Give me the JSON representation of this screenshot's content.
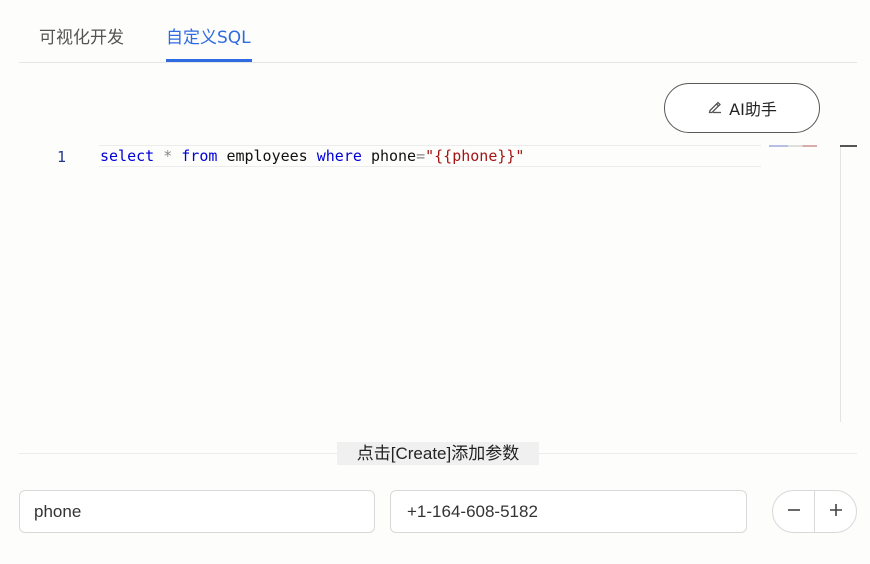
{
  "tabs": [
    {
      "label": "可视化开发",
      "active": false
    },
    {
      "label": "自定义SQL",
      "active": true
    }
  ],
  "ai_button": {
    "label": "AI助手",
    "icon": "pen-icon"
  },
  "editor": {
    "line_number": "1",
    "tokens": {
      "select": "select",
      "star": "*",
      "from": "from",
      "table": "employees",
      "where": "where",
      "column": "phone",
      "eq": "=",
      "value": "\"{{phone}}\""
    }
  },
  "params": {
    "hint": "点击[Create]添加参数",
    "rows": [
      {
        "name": "phone",
        "value": "+1-164-608-5182"
      }
    ]
  },
  "colors": {
    "accent": "#2f6be0",
    "keyword": "#0000d8",
    "string": "#a31515"
  }
}
